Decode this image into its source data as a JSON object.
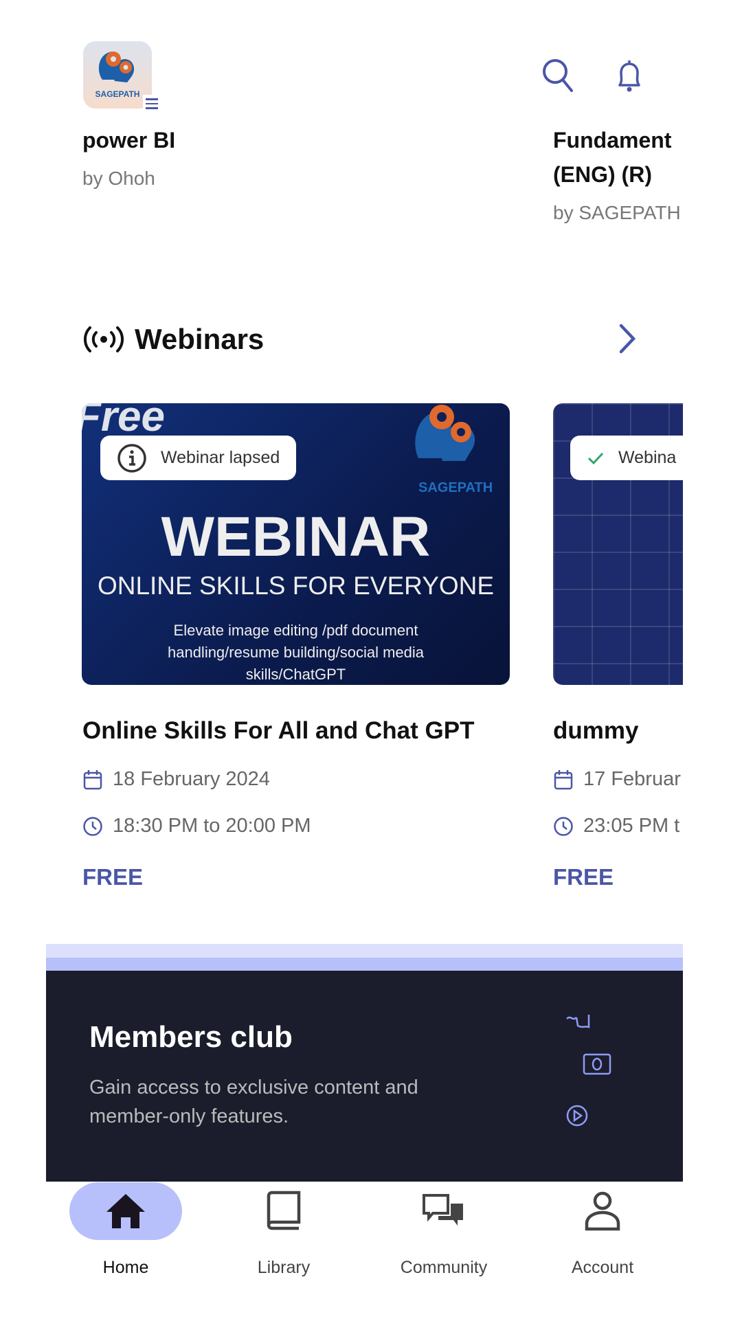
{
  "header": {
    "logo_text": "SAGEPATH",
    "icons": [
      "menu-icon",
      "search-icon",
      "bell-icon"
    ]
  },
  "courses": [
    {
      "title": "power BI",
      "author": "by Ohoh"
    },
    {
      "title_line1": "Fundament",
      "title_line2": "(ENG) (R)",
      "author": "by SAGEPATH"
    }
  ],
  "webinars": {
    "heading": "Webinars",
    "items": [
      {
        "badge": "Webinar lapsed",
        "badge_icon": "info-icon",
        "image": {
          "ribbon": "Free",
          "brand": "SAGEPATH",
          "headline": "WEBINAR",
          "subheadline": "ONLINE SKILLS FOR EVERYONE",
          "desc_line1": "Elevate image editing /pdf document",
          "desc_line2": "handling/resume building/social media",
          "desc_line3": "skills/ChatGPT"
        },
        "title": "Online Skills For All and Chat GPT",
        "date": "18 February 2024",
        "time": "18:30 PM to 20:00 PM",
        "price": "FREE"
      },
      {
        "badge": "Webina",
        "badge_icon": "check-icon",
        "title": "dummy",
        "date": "17 Februar",
        "time": "23:05 PM t",
        "price": "FREE"
      }
    ]
  },
  "members": {
    "title": "Members club",
    "description_line1": "Gain access to exclusive content and",
    "description_line2": "member-only features."
  },
  "nav": {
    "active": "Home",
    "items": [
      {
        "label": "Home"
      },
      {
        "label": "Library"
      },
      {
        "label": "Community"
      },
      {
        "label": "Account"
      }
    ]
  },
  "colors": {
    "accent": "#4a56a6",
    "active_pill": "#b7c0fb",
    "banner": "#1b1d2c"
  }
}
